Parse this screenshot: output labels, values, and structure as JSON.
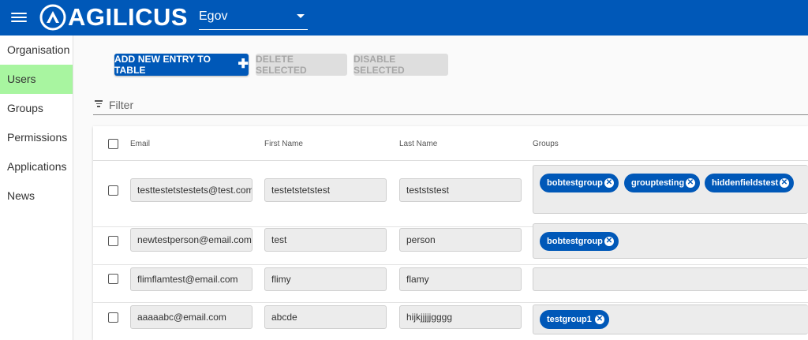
{
  "app": {
    "logo_text": "AGILICUS",
    "org_selected": "Egov"
  },
  "sidebar": {
    "items": [
      {
        "label": "Organisation",
        "active": false
      },
      {
        "label": "Users",
        "active": true
      },
      {
        "label": "Groups",
        "active": false
      },
      {
        "label": "Permissions",
        "active": false
      },
      {
        "label": "Applications",
        "active": false
      },
      {
        "label": "News",
        "active": false
      }
    ]
  },
  "toolbar": {
    "add_label": "ADD NEW ENTRY TO TABLE",
    "delete_label": "DELETE SELECTED",
    "disable_label": "DISABLE SELECTED"
  },
  "filter": {
    "placeholder": "Filter"
  },
  "table": {
    "headers": {
      "email": "Email",
      "first_name": "First Name",
      "last_name": "Last Name",
      "groups": "Groups"
    },
    "rows": [
      {
        "email": "testtestetstestets@test.com",
        "first_name": "testetstetstest",
        "last_name": "testststest",
        "groups": [
          "bobtestgroup",
          "grouptesting",
          "hiddenfieldstest"
        ]
      },
      {
        "email": "newtestperson@email.com",
        "first_name": "test",
        "last_name": "person",
        "groups": [
          "bobtestgroup"
        ]
      },
      {
        "email": "flimflamtest@email.com",
        "first_name": "flimy",
        "last_name": "flamy",
        "groups": []
      },
      {
        "email": "aaaaabc@email.com",
        "first_name": "abcde",
        "last_name": "hijkjjjjjgggg",
        "groups": [
          "testgroup1"
        ]
      }
    ]
  },
  "colors": {
    "brand": "#0058b8",
    "active_nav": "#a8f5a0"
  },
  "icons": {
    "menu": "menu-icon",
    "logo": "agilicus-logo-icon",
    "dropdown": "chevron-down-icon",
    "plus": "plus-icon",
    "filter": "filter-icon",
    "chip_remove": "close-circle-icon"
  }
}
